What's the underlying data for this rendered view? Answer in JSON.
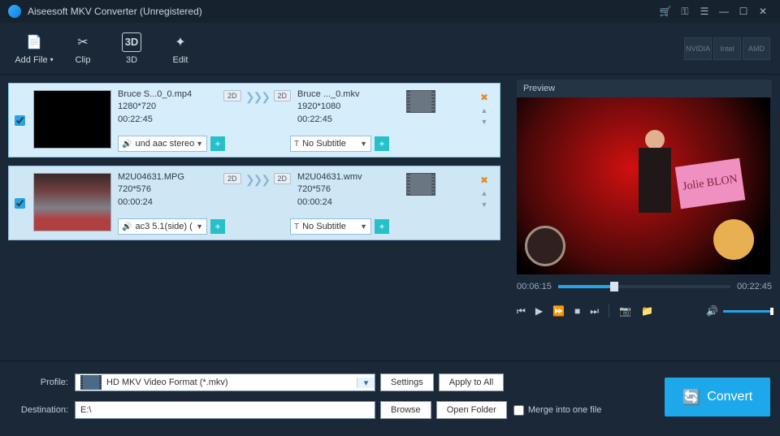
{
  "window": {
    "title": "Aiseesoft MKV Converter (Unregistered)"
  },
  "toolbar": {
    "add_file": "Add File",
    "clip": "Clip",
    "threed": "3D",
    "edit": "Edit"
  },
  "gpu": {
    "nvidia": "NVIDIA",
    "intel": "Intel",
    "amd": "AMD"
  },
  "files": [
    {
      "checked": true,
      "src_name": "Bruce S...0_0.mp4",
      "src_res": "1280*720",
      "src_dur": "00:22:45",
      "src_dim": "2D",
      "dst_name": "Bruce ..._0.mkv",
      "dst_res": "1920*1080",
      "dst_dur": "00:22:45",
      "dst_dim": "2D",
      "audio": "und aac stereo",
      "subtitle": "No Subtitle"
    },
    {
      "checked": true,
      "src_name": "M2U04631.MPG",
      "src_res": "720*576",
      "src_dur": "00:00:24",
      "src_dim": "2D",
      "dst_name": "M2U04631.wmv",
      "dst_res": "720*576",
      "dst_dur": "00:00:24",
      "dst_dim": "2D",
      "audio": "ac3 5.1(side) (",
      "subtitle": "No Subtitle"
    }
  ],
  "preview": {
    "header": "Preview",
    "sign_text": "Jolie BLON",
    "current": "00:06:15",
    "total": "00:22:45"
  },
  "bottom": {
    "profile_label": "Profile:",
    "profile_value": "HD MKV Video Format (*.mkv)",
    "settings": "Settings",
    "apply_all": "Apply to All",
    "destination_label": "Destination:",
    "destination_value": "E:\\",
    "browse": "Browse",
    "open_folder": "Open Folder",
    "merge": "Merge into one file",
    "convert": "Convert"
  }
}
